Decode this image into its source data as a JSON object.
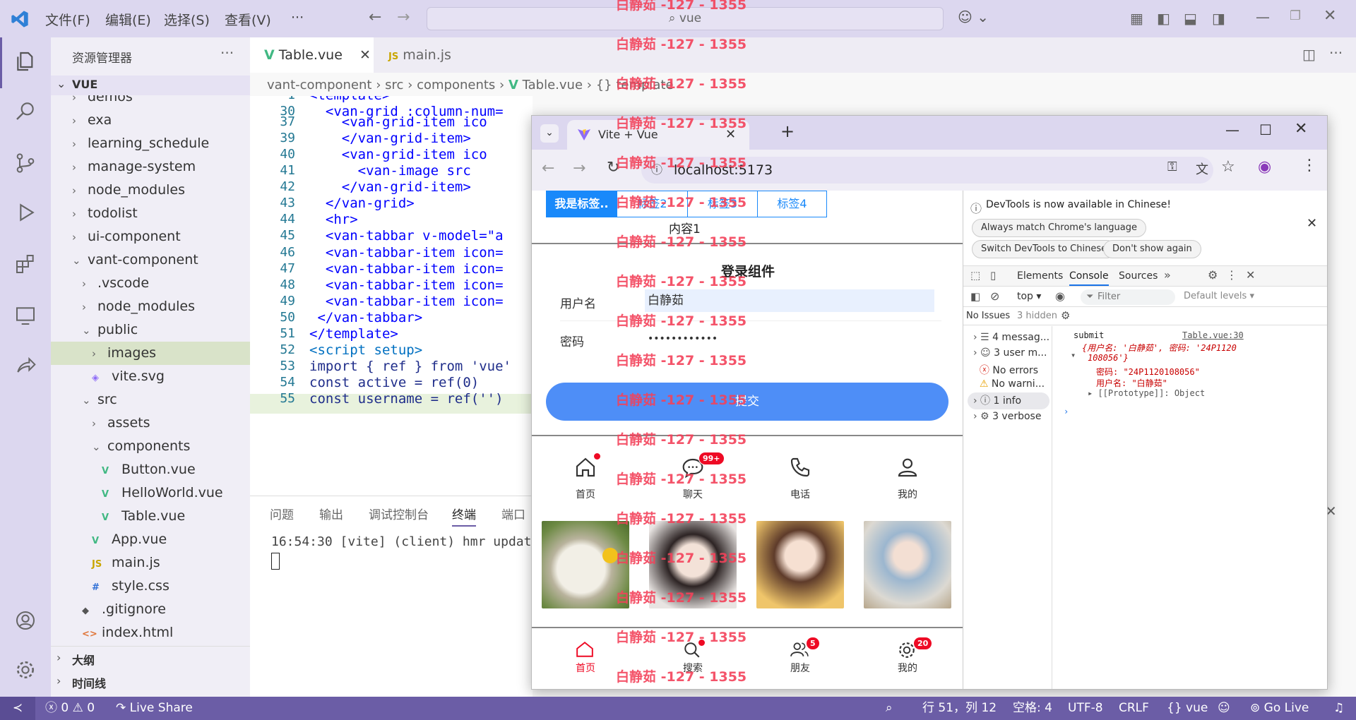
{
  "titlebar": {
    "menus": [
      "文件(F)",
      "编辑(E)",
      "选择(S)",
      "查看(V)",
      "···"
    ],
    "search": "vue"
  },
  "sidebar": {
    "title": "资源管理器",
    "root": "VUE",
    "items": [
      {
        "label": "demos",
        "indent": 0,
        "type": "folder",
        "open": false
      },
      {
        "label": "exa",
        "indent": 0,
        "type": "folder",
        "open": false
      },
      {
        "label": "learning_schedule",
        "indent": 0,
        "type": "folder",
        "open": false
      },
      {
        "label": "manage-system",
        "indent": 0,
        "type": "folder",
        "open": false
      },
      {
        "label": "node_modules",
        "indent": 0,
        "type": "folder",
        "open": false
      },
      {
        "label": "todolist",
        "indent": 0,
        "type": "folder",
        "open": false
      },
      {
        "label": "ui-component",
        "indent": 0,
        "type": "folder",
        "open": false
      },
      {
        "label": "vant-component",
        "indent": 0,
        "type": "folder",
        "open": true
      },
      {
        "label": ".vscode",
        "indent": 1,
        "type": "folder",
        "open": false
      },
      {
        "label": "node_modules",
        "indent": 1,
        "type": "folder",
        "open": false
      },
      {
        "label": "public",
        "indent": 1,
        "type": "folder",
        "open": true
      },
      {
        "label": "images",
        "indent": 2,
        "type": "folder",
        "open": false,
        "selected": true
      },
      {
        "label": "vite.svg",
        "indent": 2,
        "type": "svg"
      },
      {
        "label": "src",
        "indent": 1,
        "type": "folder",
        "open": true
      },
      {
        "label": "assets",
        "indent": 2,
        "type": "folder",
        "open": false
      },
      {
        "label": "components",
        "indent": 2,
        "type": "folder",
        "open": true
      },
      {
        "label": "Button.vue",
        "indent": 3,
        "type": "vue"
      },
      {
        "label": "HelloWorld.vue",
        "indent": 3,
        "type": "vue"
      },
      {
        "label": "Table.vue",
        "indent": 3,
        "type": "vue"
      },
      {
        "label": "App.vue",
        "indent": 2,
        "type": "vue"
      },
      {
        "label": "main.js",
        "indent": 2,
        "type": "js"
      },
      {
        "label": "style.css",
        "indent": 2,
        "type": "css"
      },
      {
        "label": ".gitignore",
        "indent": 1,
        "type": "git"
      },
      {
        "label": "index.html",
        "indent": 1,
        "type": "html"
      }
    ],
    "outline": "大纲",
    "timeline": "时间线"
  },
  "editor": {
    "tabs": [
      "Table.vue",
      "main.js"
    ],
    "breadcrumb": [
      "vant-component",
      "src",
      "components",
      "Table.vue",
      "{} template"
    ],
    "lines": [
      {
        "n": "1",
        "t": "<template>"
      },
      {
        "n": "30",
        "t": "  <van-grid :column-num="
      },
      {
        "n": "37",
        "t": "    <van-grid-item ico"
      },
      {
        "n": "39",
        "t": "    </van-grid-item>"
      },
      {
        "n": "40",
        "t": "    <van-grid-item ico"
      },
      {
        "n": "41",
        "t": "      <van-image src"
      },
      {
        "n": "42",
        "t": "    </van-grid-item>"
      },
      {
        "n": "43",
        "t": "  </van-grid>"
      },
      {
        "n": "44",
        "t": "  <hr>"
      },
      {
        "n": "45",
        "t": "  <van-tabbar v-model=\"a"
      },
      {
        "n": "46",
        "t": "  <van-tabbar-item icon="
      },
      {
        "n": "47",
        "t": "  <van-tabbar-item icon="
      },
      {
        "n": "48",
        "t": "  <van-tabbar-item icon="
      },
      {
        "n": "49",
        "t": "  <van-tabbar-item icon="
      },
      {
        "n": "50",
        "t": " </van-tabbar>"
      },
      {
        "n": "51",
        "t": "</template>"
      },
      {
        "n": "52",
        "t": "<script setup>"
      },
      {
        "n": "53",
        "t": "import { ref } from 'vue'"
      },
      {
        "n": "54",
        "t": "const active = ref(0)"
      },
      {
        "n": "55",
        "t": "const username = ref('')"
      }
    ]
  },
  "panel": {
    "tabs": [
      "问题",
      "输出",
      "调试控制台",
      "终端",
      "端口"
    ],
    "terminal": "16:54:30 [vite] (client) hmr updat"
  },
  "browser": {
    "tab_title": "Vite + Vue",
    "url": "localhost:5173",
    "page": {
      "tabs": [
        "我是标签..",
        "标签2",
        "标签3",
        "标签4"
      ],
      "tab_content": "内容1",
      "login_title": "登录组件",
      "username_label": "用户名",
      "username_value": "白静茹",
      "password_label": "密码",
      "password_value": "••••••••••••",
      "submit": "提交",
      "grid": [
        {
          "label": "首页",
          "icon": "home-icon",
          "badge": "dot"
        },
        {
          "label": "聊天",
          "icon": "chat-icon",
          "badge": "99+"
        },
        {
          "label": "电话",
          "icon": "phone-icon",
          "badge": ""
        },
        {
          "label": "我的",
          "icon": "user-icon",
          "badge": ""
        }
      ],
      "tabbar": [
        {
          "label": "首页",
          "badge": ""
        },
        {
          "label": "搜索",
          "badge": "dot"
        },
        {
          "label": "朋友",
          "badge": "5"
        },
        {
          "label": "我的",
          "badge": "20"
        }
      ]
    },
    "devtools": {
      "notice": "DevTools is now available in Chinese!",
      "btn_match": "Always match Chrome's language",
      "btn_switch": "Switch DevTools to Chinese",
      "btn_dont": "Don't show again",
      "tabs": [
        "Elements",
        "Console",
        "Sources"
      ],
      "context": "top",
      "filter": "Filter",
      "levels": "Default levels",
      "issues": "No Issues",
      "hidden": "3 hidden",
      "sidebar": [
        "4 messag...",
        "3 user m...",
        "No errors",
        "No warni...",
        "1 info",
        "3 verbose"
      ],
      "log_text": "submit",
      "log_source": "Table.vue:30",
      "log_obj": "{用户名: '白静茹', 密码: '24P1120",
      "log_obj2": "108056'}",
      "log_pw": "密码: \"24P1120108056\"",
      "log_user": "用户名: \"白静茹\"",
      "log_proto": "[[Prototype]]: Object"
    }
  },
  "statusbar": {
    "problems": "0",
    "warnings": "0",
    "live_share": "Live Share",
    "position": "行 51，列 12",
    "spaces": "空格: 4",
    "encoding": "UTF-8",
    "eol": "CRLF",
    "language": "vue",
    "go_live": "Go Live"
  },
  "watermark": "白静茹 -127 - 1355"
}
